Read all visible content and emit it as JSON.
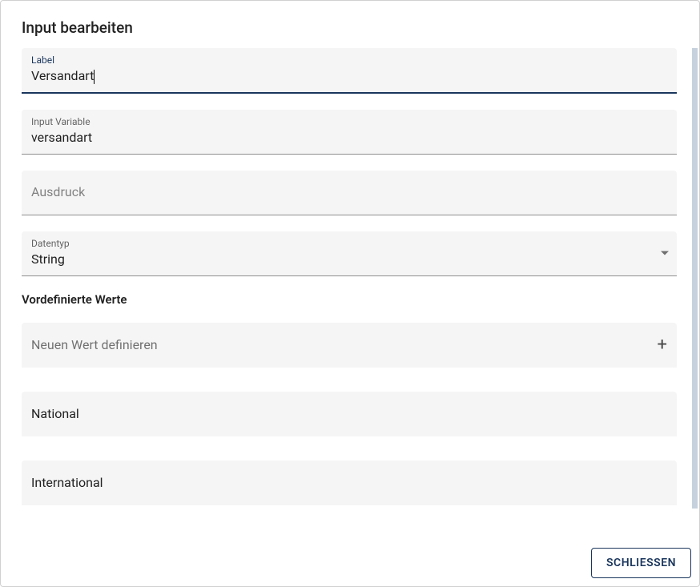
{
  "dialog": {
    "title": "Input bearbeiten"
  },
  "fields": {
    "label": {
      "label": "Label",
      "value": "Versandart"
    },
    "variable": {
      "label": "Input Variable",
      "value": "versandart"
    },
    "expression": {
      "placeholder": "Ausdruck",
      "value": ""
    },
    "datatype": {
      "label": "Datentyp",
      "value": "String"
    }
  },
  "predefined": {
    "heading": "Vordefinierte Werte",
    "add_label": "Neuen Wert definieren",
    "values": [
      "National",
      "International"
    ]
  },
  "footer": {
    "close": "Schliessen"
  }
}
